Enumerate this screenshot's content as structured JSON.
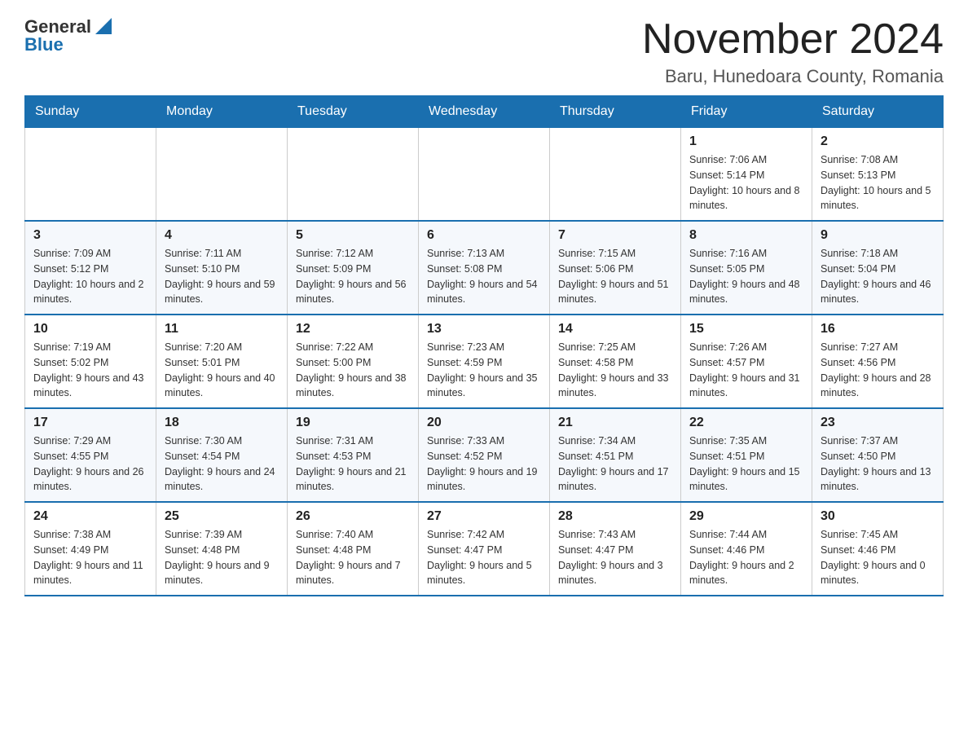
{
  "logo": {
    "text_general": "General",
    "text_blue": "Blue"
  },
  "header": {
    "month_title": "November 2024",
    "location": "Baru, Hunedoara County, Romania"
  },
  "weekdays": [
    "Sunday",
    "Monday",
    "Tuesday",
    "Wednesday",
    "Thursday",
    "Friday",
    "Saturday"
  ],
  "weeks": [
    [
      {
        "day": "",
        "info": ""
      },
      {
        "day": "",
        "info": ""
      },
      {
        "day": "",
        "info": ""
      },
      {
        "day": "",
        "info": ""
      },
      {
        "day": "",
        "info": ""
      },
      {
        "day": "1",
        "info": "Sunrise: 7:06 AM\nSunset: 5:14 PM\nDaylight: 10 hours and 8 minutes."
      },
      {
        "day": "2",
        "info": "Sunrise: 7:08 AM\nSunset: 5:13 PM\nDaylight: 10 hours and 5 minutes."
      }
    ],
    [
      {
        "day": "3",
        "info": "Sunrise: 7:09 AM\nSunset: 5:12 PM\nDaylight: 10 hours and 2 minutes."
      },
      {
        "day": "4",
        "info": "Sunrise: 7:11 AM\nSunset: 5:10 PM\nDaylight: 9 hours and 59 minutes."
      },
      {
        "day": "5",
        "info": "Sunrise: 7:12 AM\nSunset: 5:09 PM\nDaylight: 9 hours and 56 minutes."
      },
      {
        "day": "6",
        "info": "Sunrise: 7:13 AM\nSunset: 5:08 PM\nDaylight: 9 hours and 54 minutes."
      },
      {
        "day": "7",
        "info": "Sunrise: 7:15 AM\nSunset: 5:06 PM\nDaylight: 9 hours and 51 minutes."
      },
      {
        "day": "8",
        "info": "Sunrise: 7:16 AM\nSunset: 5:05 PM\nDaylight: 9 hours and 48 minutes."
      },
      {
        "day": "9",
        "info": "Sunrise: 7:18 AM\nSunset: 5:04 PM\nDaylight: 9 hours and 46 minutes."
      }
    ],
    [
      {
        "day": "10",
        "info": "Sunrise: 7:19 AM\nSunset: 5:02 PM\nDaylight: 9 hours and 43 minutes."
      },
      {
        "day": "11",
        "info": "Sunrise: 7:20 AM\nSunset: 5:01 PM\nDaylight: 9 hours and 40 minutes."
      },
      {
        "day": "12",
        "info": "Sunrise: 7:22 AM\nSunset: 5:00 PM\nDaylight: 9 hours and 38 minutes."
      },
      {
        "day": "13",
        "info": "Sunrise: 7:23 AM\nSunset: 4:59 PM\nDaylight: 9 hours and 35 minutes."
      },
      {
        "day": "14",
        "info": "Sunrise: 7:25 AM\nSunset: 4:58 PM\nDaylight: 9 hours and 33 minutes."
      },
      {
        "day": "15",
        "info": "Sunrise: 7:26 AM\nSunset: 4:57 PM\nDaylight: 9 hours and 31 minutes."
      },
      {
        "day": "16",
        "info": "Sunrise: 7:27 AM\nSunset: 4:56 PM\nDaylight: 9 hours and 28 minutes."
      }
    ],
    [
      {
        "day": "17",
        "info": "Sunrise: 7:29 AM\nSunset: 4:55 PM\nDaylight: 9 hours and 26 minutes."
      },
      {
        "day": "18",
        "info": "Sunrise: 7:30 AM\nSunset: 4:54 PM\nDaylight: 9 hours and 24 minutes."
      },
      {
        "day": "19",
        "info": "Sunrise: 7:31 AM\nSunset: 4:53 PM\nDaylight: 9 hours and 21 minutes."
      },
      {
        "day": "20",
        "info": "Sunrise: 7:33 AM\nSunset: 4:52 PM\nDaylight: 9 hours and 19 minutes."
      },
      {
        "day": "21",
        "info": "Sunrise: 7:34 AM\nSunset: 4:51 PM\nDaylight: 9 hours and 17 minutes."
      },
      {
        "day": "22",
        "info": "Sunrise: 7:35 AM\nSunset: 4:51 PM\nDaylight: 9 hours and 15 minutes."
      },
      {
        "day": "23",
        "info": "Sunrise: 7:37 AM\nSunset: 4:50 PM\nDaylight: 9 hours and 13 minutes."
      }
    ],
    [
      {
        "day": "24",
        "info": "Sunrise: 7:38 AM\nSunset: 4:49 PM\nDaylight: 9 hours and 11 minutes."
      },
      {
        "day": "25",
        "info": "Sunrise: 7:39 AM\nSunset: 4:48 PM\nDaylight: 9 hours and 9 minutes."
      },
      {
        "day": "26",
        "info": "Sunrise: 7:40 AM\nSunset: 4:48 PM\nDaylight: 9 hours and 7 minutes."
      },
      {
        "day": "27",
        "info": "Sunrise: 7:42 AM\nSunset: 4:47 PM\nDaylight: 9 hours and 5 minutes."
      },
      {
        "day": "28",
        "info": "Sunrise: 7:43 AM\nSunset: 4:47 PM\nDaylight: 9 hours and 3 minutes."
      },
      {
        "day": "29",
        "info": "Sunrise: 7:44 AM\nSunset: 4:46 PM\nDaylight: 9 hours and 2 minutes."
      },
      {
        "day": "30",
        "info": "Sunrise: 7:45 AM\nSunset: 4:46 PM\nDaylight: 9 hours and 0 minutes."
      }
    ]
  ]
}
